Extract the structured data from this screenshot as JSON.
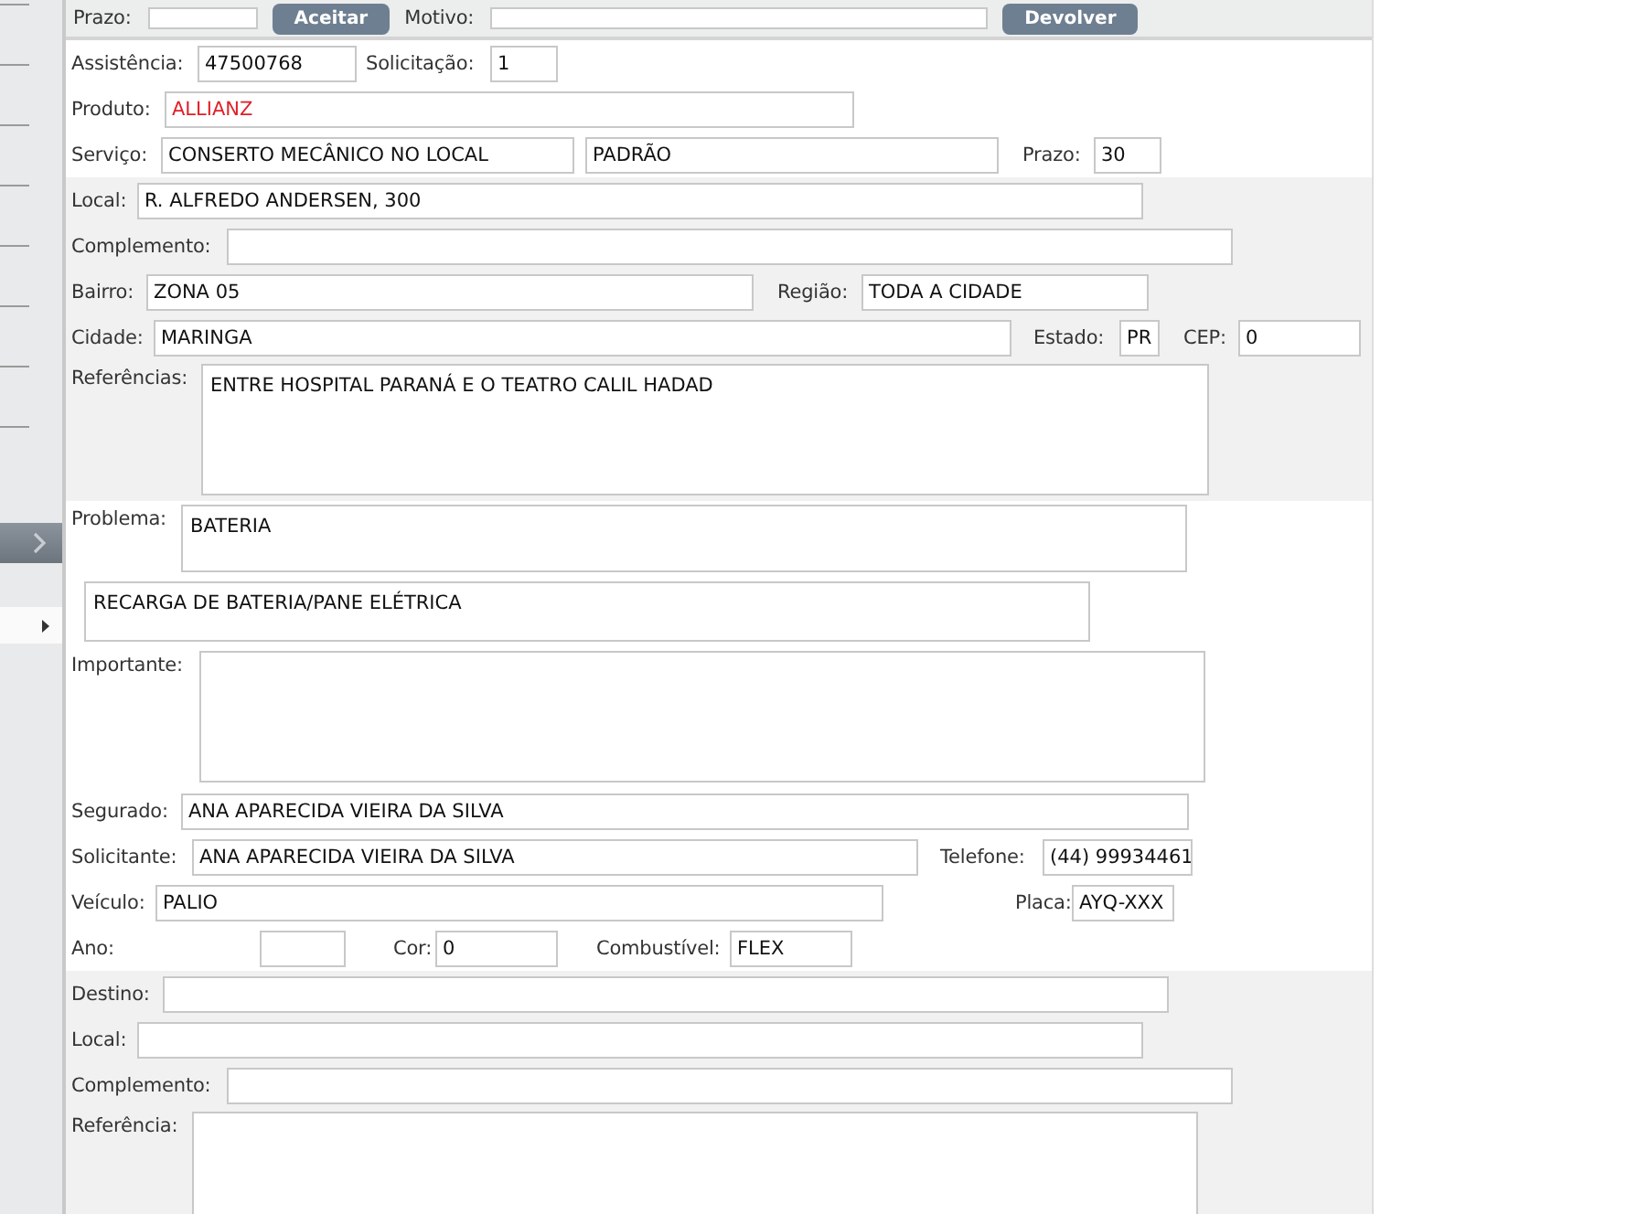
{
  "top_bar": {
    "items": [
      {
        "kind": "label",
        "text": "Prazo:"
      },
      {
        "kind": "field",
        "value": ""
      },
      {
        "kind": "button",
        "text": "Aceitar"
      },
      {
        "kind": "label",
        "text": "Motivo:"
      },
      {
        "kind": "field",
        "value": ""
      },
      {
        "kind": "button",
        "text": "Devolver"
      }
    ]
  },
  "sections": [
    {
      "shaded": false,
      "rows": [
        {
          "items": [
            {
              "kind": "label",
              "text": "Assistência:"
            },
            {
              "kind": "field",
              "value": "47500768"
            },
            {
              "kind": "label",
              "text": "Solicitação:"
            },
            {
              "kind": "field",
              "value": "1"
            }
          ]
        },
        {
          "items": [
            {
              "kind": "label",
              "text": "Produto:"
            },
            {
              "kind": "field",
              "value": "ALLIANZ",
              "color": "#e0202a"
            }
          ]
        },
        {
          "items": [
            {
              "kind": "label",
              "text": "Serviço:"
            },
            {
              "kind": "field",
              "value": "CONSERTO MECÂNICO NO LOCAL"
            },
            {
              "kind": "field",
              "value": "PADRÃO"
            },
            {
              "kind": "label",
              "text": "Prazo:"
            },
            {
              "kind": "field",
              "value": "30"
            }
          ]
        }
      ]
    },
    {
      "shaded": true,
      "rows": [
        {
          "items": [
            {
              "kind": "label",
              "text": "Local:"
            },
            {
              "kind": "field",
              "value": "R. ALFREDO ANDERSEN, 300"
            }
          ]
        },
        {
          "items": [
            {
              "kind": "label",
              "text": "Complemento:"
            },
            {
              "kind": "field",
              "value": ""
            }
          ]
        },
        {
          "items": [
            {
              "kind": "label",
              "text": "Bairro:"
            },
            {
              "kind": "field",
              "value": "ZONA 05"
            },
            {
              "kind": "label",
              "text": "Região:"
            },
            {
              "kind": "field",
              "value": "TODA A CIDADE"
            }
          ]
        },
        {
          "items": [
            {
              "kind": "label",
              "text": "Cidade:"
            },
            {
              "kind": "field",
              "value": "MARINGA"
            },
            {
              "kind": "label",
              "text": "Estado:"
            },
            {
              "kind": "field",
              "value": "PR"
            },
            {
              "kind": "label",
              "text": "CEP:"
            },
            {
              "kind": "field",
              "value": "0"
            }
          ]
        },
        {
          "items": [
            {
              "kind": "label",
              "text": "Referências:"
            },
            {
              "kind": "textarea",
              "value": "ENTRE HOSPITAL PARANÁ E O TEATRO CALIL HADAD"
            }
          ]
        }
      ]
    },
    {
      "shaded": false,
      "rows": [
        {
          "items": [
            {
              "kind": "label",
              "text": "Problema:"
            },
            {
              "kind": "textarea",
              "value": "BATERIA"
            }
          ]
        },
        {
          "items": [
            {
              "kind": "textarea",
              "value": "RECARGA DE BATERIA/PANE ELÉTRICA"
            }
          ]
        },
        {
          "items": [
            {
              "kind": "label",
              "text": "Importante:"
            },
            {
              "kind": "textarea",
              "value": ""
            }
          ]
        },
        {
          "items": [
            {
              "kind": "label",
              "text": "Segurado:"
            },
            {
              "kind": "field",
              "value": "ANA APARECIDA VIEIRA DA SILVA"
            }
          ]
        },
        {
          "items": [
            {
              "kind": "label",
              "text": "Solicitante:"
            },
            {
              "kind": "field",
              "value": "ANA APARECIDA VIEIRA DA SILVA"
            },
            {
              "kind": "label",
              "text": "Telefone:"
            },
            {
              "kind": "field",
              "value": "(44) 99934461"
            }
          ]
        },
        {
          "items": [
            {
              "kind": "label",
              "text": "Veículo:"
            },
            {
              "kind": "field",
              "value": "PALIO"
            },
            {
              "kind": "label",
              "text": "Placa:"
            },
            {
              "kind": "field",
              "value": "AYQ-XXX"
            }
          ]
        },
        {
          "items": [
            {
              "kind": "label",
              "text": "Ano:"
            },
            {
              "kind": "field",
              "value": ""
            },
            {
              "kind": "label",
              "text": "Cor:"
            },
            {
              "kind": "field",
              "value": "0"
            },
            {
              "kind": "label",
              "text": "Combustível:"
            },
            {
              "kind": "field",
              "value": "FLEX"
            }
          ]
        }
      ]
    },
    {
      "shaded": true,
      "rows": [
        {
          "items": [
            {
              "kind": "label",
              "text": "Destino:"
            },
            {
              "kind": "field",
              "value": ""
            }
          ]
        },
        {
          "items": [
            {
              "kind": "label",
              "text": "Local:"
            },
            {
              "kind": "field",
              "value": ""
            }
          ]
        },
        {
          "items": [
            {
              "kind": "label",
              "text": "Complemento:"
            },
            {
              "kind": "field",
              "value": ""
            }
          ]
        },
        {
          "items": [
            {
              "kind": "label",
              "text": "Referência:"
            },
            {
              "kind": "textarea",
              "value": ""
            }
          ]
        }
      ]
    }
  ]
}
